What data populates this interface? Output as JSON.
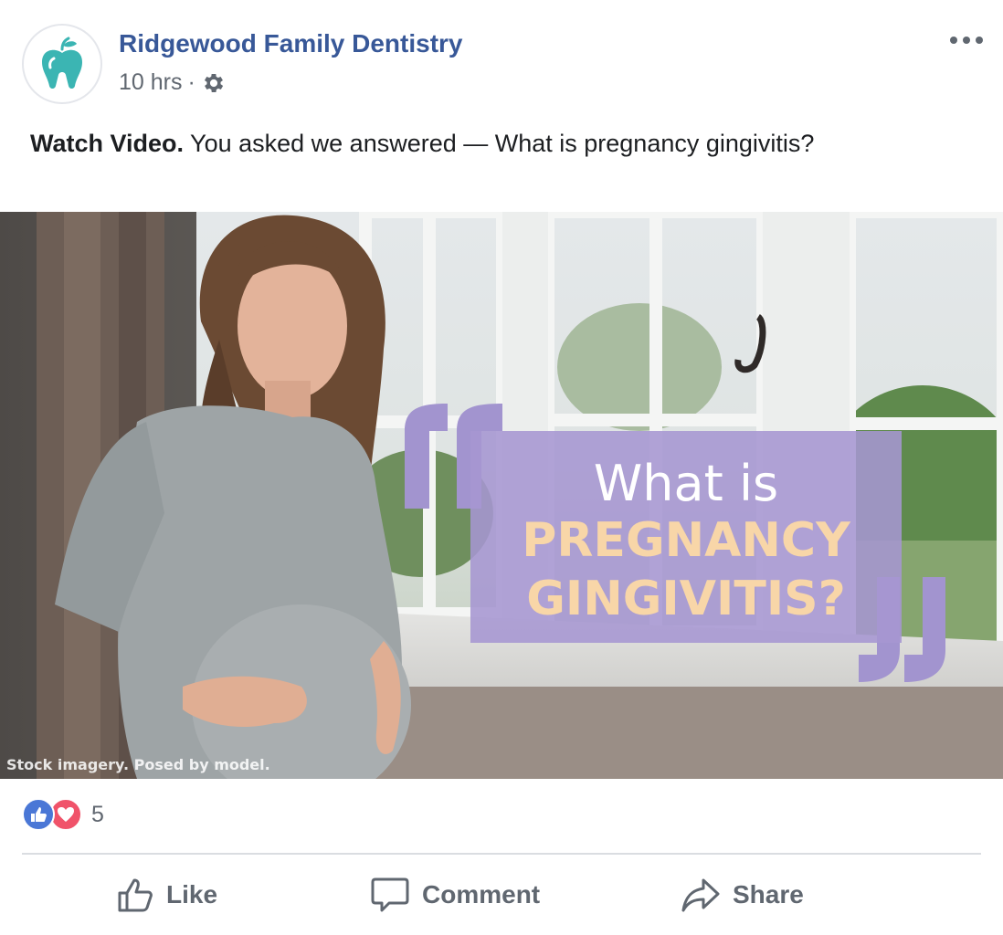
{
  "post": {
    "page_name": "Ridgewood Family Dentistry",
    "time": "10 hrs",
    "separator": "·",
    "text_bold": "Watch Video.",
    "text_rest": " You asked we answered — What is pregnancy gingivitis?"
  },
  "media": {
    "overlay_line1": "What is",
    "overlay_line2": "PREGNANCY",
    "overlay_line3": "GINGIVITIS?",
    "caption": "Stock imagery. Posed by model."
  },
  "reactions": {
    "count": "5",
    "icons": [
      "like-icon",
      "love-icon"
    ]
  },
  "actions": {
    "like": "Like",
    "comment": "Comment",
    "share": "Share"
  },
  "colors": {
    "page_name": "#385898",
    "secondary_text": "#606770",
    "overlay_box": "#a696d2",
    "overlay_accent": "#f8d6a8",
    "like_blue": "#4a77d6",
    "love_red": "#f0536a",
    "logo_teal": "#3bb5b3"
  }
}
